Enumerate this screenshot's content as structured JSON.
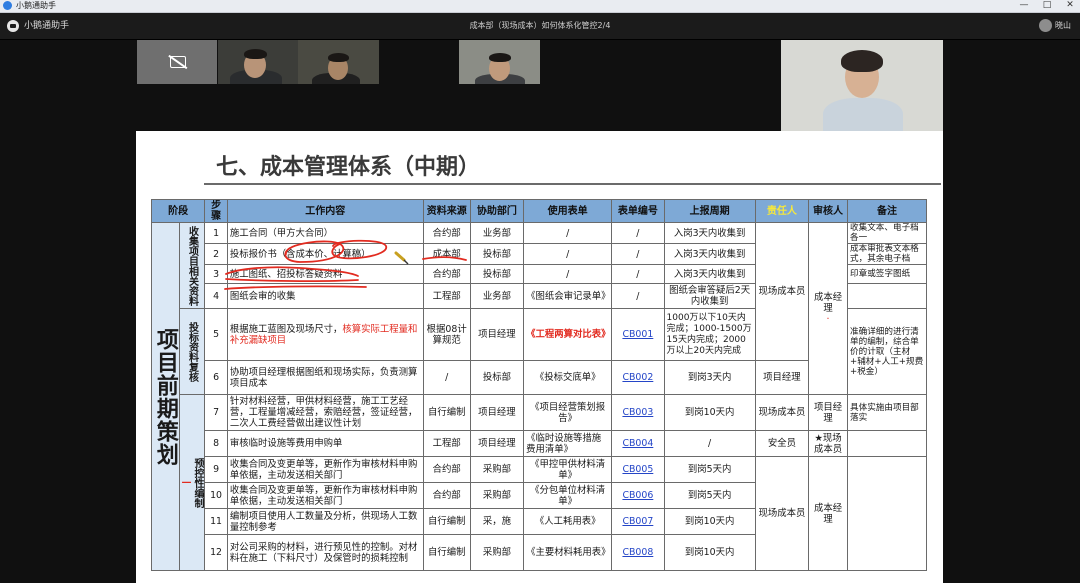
{
  "window": {
    "title": "小鹅通助手",
    "controls": [
      "—",
      "□",
      "✕"
    ]
  },
  "meeting": {
    "app_name": "小鹅通助手",
    "title": "成本部（现场成本）如何体系化管控2/4",
    "user_name": "晓山"
  },
  "slide": {
    "title": "七、成本管理体系（中期）",
    "headers": [
      "阶段",
      "步骤",
      "工作内容",
      "资料来源",
      "协助部门",
      "使用表单",
      "表单编号",
      "上报周期",
      "责任人",
      "审核人",
      "备注"
    ],
    "stage": "项目前期策划",
    "groups": [
      {
        "label": "收集项目相关资料"
      },
      {
        "label": "投标资料复核"
      },
      {
        "label": "预控性编制"
      }
    ],
    "rows": [
      {
        "step": "1",
        "content": "施工合同（甲方大合同）",
        "source": "合约部",
        "dept": "业务部",
        "form": "/",
        "code": "/",
        "period": "入岗3天内收集到",
        "note": "收集文本、电子档各一"
      },
      {
        "step": "2",
        "content": "投标报价书（含成本价、计算稿）",
        "source": "成本部",
        "dept": "投标部",
        "form": "/",
        "code": "/",
        "period": "入岗3天内收集到",
        "note": "成本审批表文本格式，其余电子档"
      },
      {
        "step": "3",
        "content": "施工图纸、招投标答疑资料",
        "source": "合约部",
        "dept": "投标部",
        "form": "/",
        "code": "/",
        "period": "入岗3天内收集到",
        "note": "印章或签字图纸"
      },
      {
        "step": "4",
        "content": "图纸会审的收集",
        "source": "工程部",
        "dept": "业务部",
        "form": "《图纸会审记录单》",
        "code": "/",
        "period": "图纸会审答疑后2天内收集到",
        "note": ""
      },
      {
        "step": "5",
        "content_a": "根据施工蓝图及现场尺寸，",
        "content_b": "核算实际工程量和补充漏缺项目",
        "source": "根据08计算规范",
        "dept": "项目经理",
        "form": "《工程两算对比表》",
        "code": "CB001",
        "period": "1000万以下10天内完成；1000-1500万15天内完成；2000万以上20天内完成",
        "note": "准确详细的进行清单的编制，综合单价的计取（主材+辅材+人工+规费+税金）"
      },
      {
        "step": "6",
        "content": "协助项目经理根据图纸和现场实际，负责测算项目成本",
        "source": "/",
        "dept": "投标部",
        "form": "《投标交底单》",
        "code": "CB002",
        "period": "到岗3天内",
        "note": ""
      },
      {
        "step": "7",
        "content": "针对材料经营，甲供材料经营，施工工艺经营，工程量增减经营，索赔经营，签证经营，二次人工费经营做出建议性计划",
        "source": "自行编制",
        "dept": "项目经理",
        "form": "《项目经营策划报告》",
        "code": "CB003",
        "period": "到岗10天内",
        "note": "具体实施由项目部落实"
      },
      {
        "step": "8",
        "content": "审核临时设施等费用申购单",
        "source": "工程部",
        "dept": "项目经理",
        "form": "《临时设施等措施费用清单》",
        "code": "CB004",
        "period": "/",
        "note": ""
      },
      {
        "step": "9",
        "content": "收集合同及变更单等，更新作为审核材料申购单依据，主动发送相关部门",
        "source": "合约部",
        "dept": "采购部",
        "form": "《甲控甲供材料清单》",
        "code": "CB005",
        "period": "到岗5天内",
        "note": ""
      },
      {
        "step": "10",
        "content": "收集合同及变更单等，更新作为审核材料申购单依据，主动发送相关部门",
        "source": "合约部",
        "dept": "采购部",
        "form": "《分包单位材料清单》",
        "code": "CB006",
        "period": "到岗5天内",
        "note": ""
      },
      {
        "step": "11",
        "content": "编制项目使用人工数量及分析，供现场人工数量控制参考",
        "source": "自行编制",
        "dept": "采，施",
        "form": "《人工耗用表》",
        "code": "CB007",
        "period": "到岗10天内",
        "note": ""
      },
      {
        "step": "12",
        "content": "对公司采购的材料，进行预见性的控制。对材料在施工（下料尺寸）及保管时的损耗控制",
        "source": "自行编制",
        "dept": "采购部",
        "form": "《主要材料耗用表》",
        "code": "CB008",
        "period": "到岗10天内",
        "note": ""
      }
    ],
    "responsible": {
      "r1_5": "现场成本员",
      "r6": "项目经理",
      "r7": "现场成本员",
      "r8": "安全员",
      "r9_12": "现场成本员"
    },
    "reviewer": {
      "r1_6": "成本经理",
      "r7": "项目经理",
      "r8": "★现场成本员",
      "r9_12": "成本经理"
    }
  },
  "colors": {
    "header_bg": "#7ea9d6",
    "stage_bg": "#dbe8f5",
    "ink_red": "#e22b20",
    "link": "#2445c7"
  }
}
